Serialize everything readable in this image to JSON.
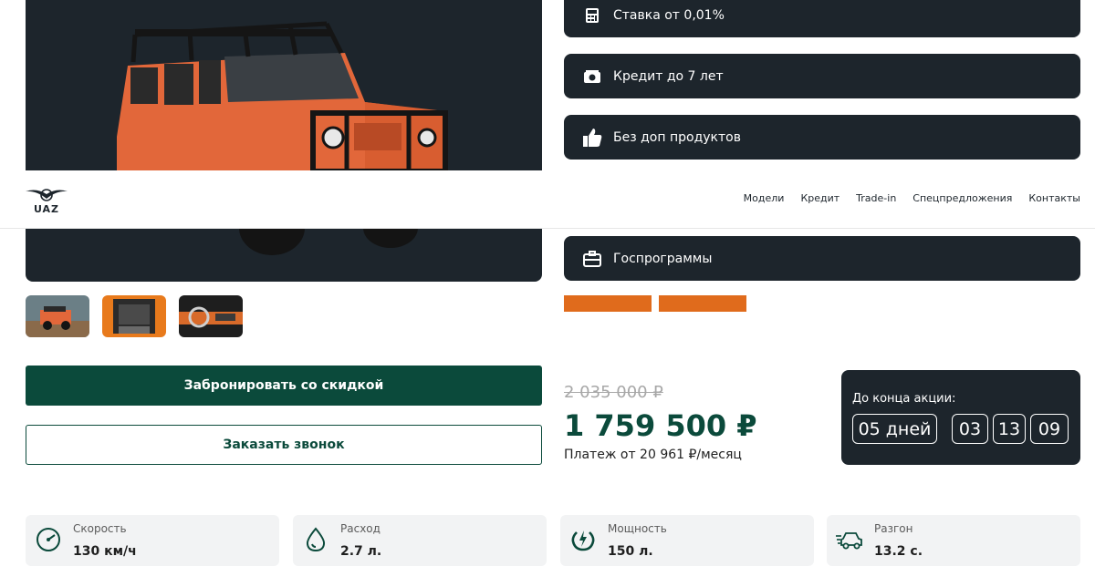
{
  "features": [
    {
      "icon": "calculator-icon",
      "label": "Ставка от 0,01%"
    },
    {
      "icon": "money-icon",
      "label": "Кредит до 7 лет"
    },
    {
      "icon": "thumbs-up-icon",
      "label": "Без доп продуктов"
    },
    {
      "icon": "briefcase-icon",
      "label": "Госпрограммы"
    }
  ],
  "header": {
    "logo_text": "UAZ",
    "nav": [
      "Модели",
      "Кредит",
      "Trade-in",
      "Спецпредложения",
      "Контакты"
    ]
  },
  "hero": {
    "image": "orange-suv-photo"
  },
  "thumbnails": [
    "exterior-photo",
    "trunk-photo",
    "interior-photo"
  ],
  "buttons": {
    "book": "Забронировать со скидкой",
    "call": "Заказать звонок"
  },
  "price": {
    "old": "2 035 000 ₽",
    "new": "1 759 500 ₽",
    "payment": "Платеж от 20 961 ₽/месяц"
  },
  "countdown": {
    "title": "До конца акции:",
    "days": "05 дней",
    "hours": "03",
    "minutes": "13",
    "seconds": "09"
  },
  "specs": [
    {
      "icon": "speedometer-icon",
      "label": "Скорость",
      "value": "130 км/ч"
    },
    {
      "icon": "fuel-drop-icon",
      "label": "Расход",
      "value": "2.7 л."
    },
    {
      "icon": "power-icon",
      "label": "Мощность",
      "value": "150 л."
    },
    {
      "icon": "car-speed-icon",
      "label": "Разгон",
      "value": "13.2 с."
    }
  ],
  "colors": {
    "dark": "#1d252c",
    "brand_green": "#0b4a3b",
    "accent_orange": "#e06b1c"
  }
}
